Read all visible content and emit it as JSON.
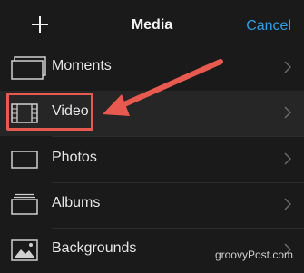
{
  "header": {
    "title": "Media",
    "cancel_label": "Cancel",
    "add_icon": "plus-icon"
  },
  "list": {
    "items": [
      {
        "label": "Moments",
        "icon": "moments-icon"
      },
      {
        "label": "Video",
        "icon": "film-strip-icon"
      },
      {
        "label": "Photos",
        "icon": "photo-frame-icon"
      },
      {
        "label": "Albums",
        "icon": "albums-icon"
      },
      {
        "label": "Backgrounds",
        "icon": "landscape-icon"
      }
    ]
  },
  "watermark": "groovyPost.com",
  "colors": {
    "background": "#1a1a1a",
    "selected_row": "#2a2a2a",
    "accent": "#2fa0e6",
    "annotation": "#e85a4f"
  }
}
